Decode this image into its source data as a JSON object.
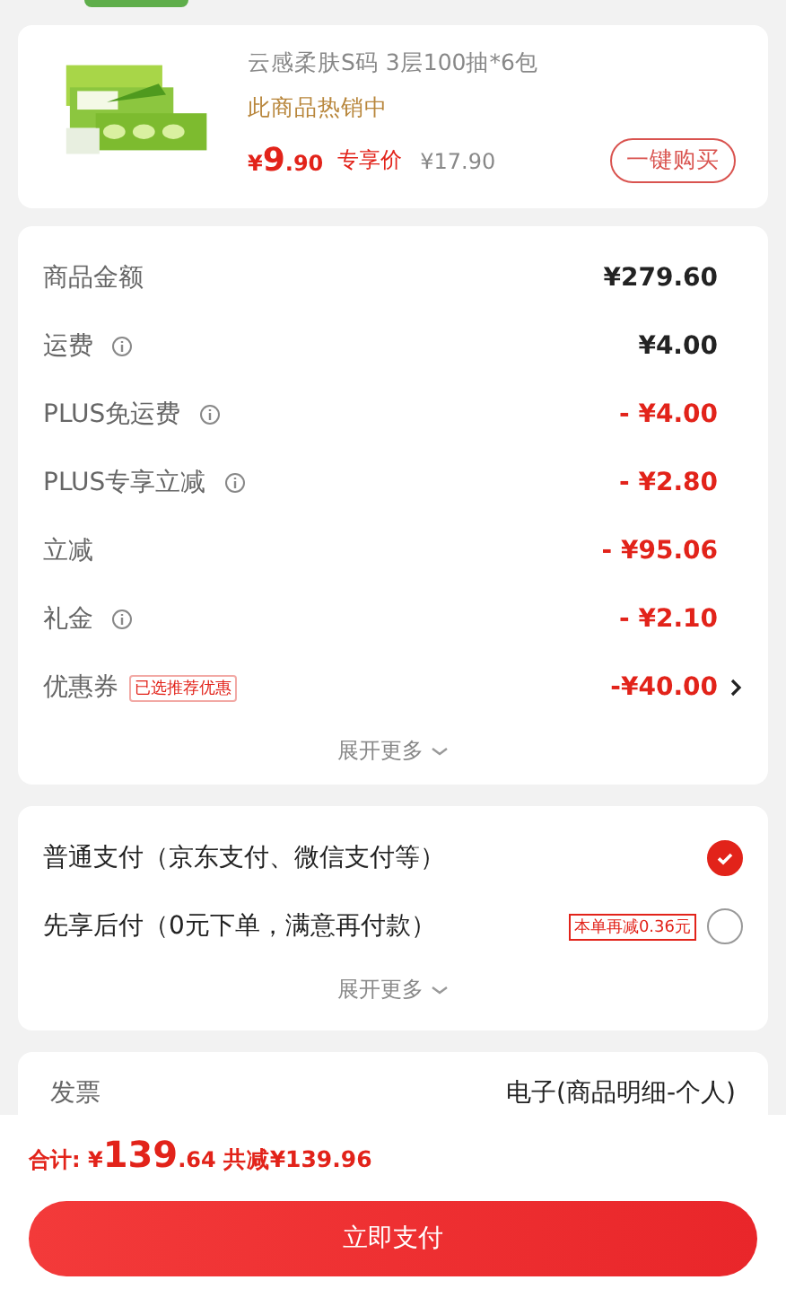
{
  "product": {
    "name": "云感柔肤S码 3层100抽*6包",
    "status": "此商品热销中",
    "price_currency": "¥",
    "price_integer": "9",
    "price_decimal": ".90",
    "price_label": "专享价",
    "original_price": "¥17.90",
    "buy_button": "一键购买"
  },
  "summary": {
    "rows": [
      {
        "label": "商品金额",
        "value": "¥279.60",
        "info": false,
        "discount": false,
        "arrow": false
      },
      {
        "label": "运费",
        "value": "¥4.00",
        "info": true,
        "discount": false,
        "arrow": false
      },
      {
        "label": "PLUS免运费",
        "value": "- ¥4.00",
        "info": true,
        "discount": true,
        "arrow": false
      },
      {
        "label": "PLUS专享立减",
        "value": "- ¥2.80",
        "info": true,
        "discount": true,
        "arrow": false
      },
      {
        "label": "立减",
        "value": "- ¥95.06",
        "info": false,
        "discount": true,
        "arrow": false
      },
      {
        "label": "礼金",
        "value": "- ¥2.10",
        "info": true,
        "discount": true,
        "arrow": false
      },
      {
        "label": "优惠券",
        "tag": "已选推荐优惠",
        "value": "-¥40.00",
        "info": false,
        "discount": true,
        "arrow": true
      }
    ],
    "expand": "展开更多"
  },
  "payment": {
    "options": [
      {
        "label": "普通支付（京东支付、微信支付等）",
        "selected": true
      },
      {
        "label": "先享后付（0元下单，满意再付款）",
        "badge": "本单再减0.36元",
        "selected": false
      }
    ],
    "expand": "展开更多"
  },
  "invoice": {
    "label": "发票",
    "value": "电子(商品明细-个人)"
  },
  "footer": {
    "total_label": "合计:",
    "currency": "¥",
    "total_integer": "139",
    "total_decimal": ".64",
    "savings": "共减¥139.96",
    "pay_button": "立即支付"
  }
}
